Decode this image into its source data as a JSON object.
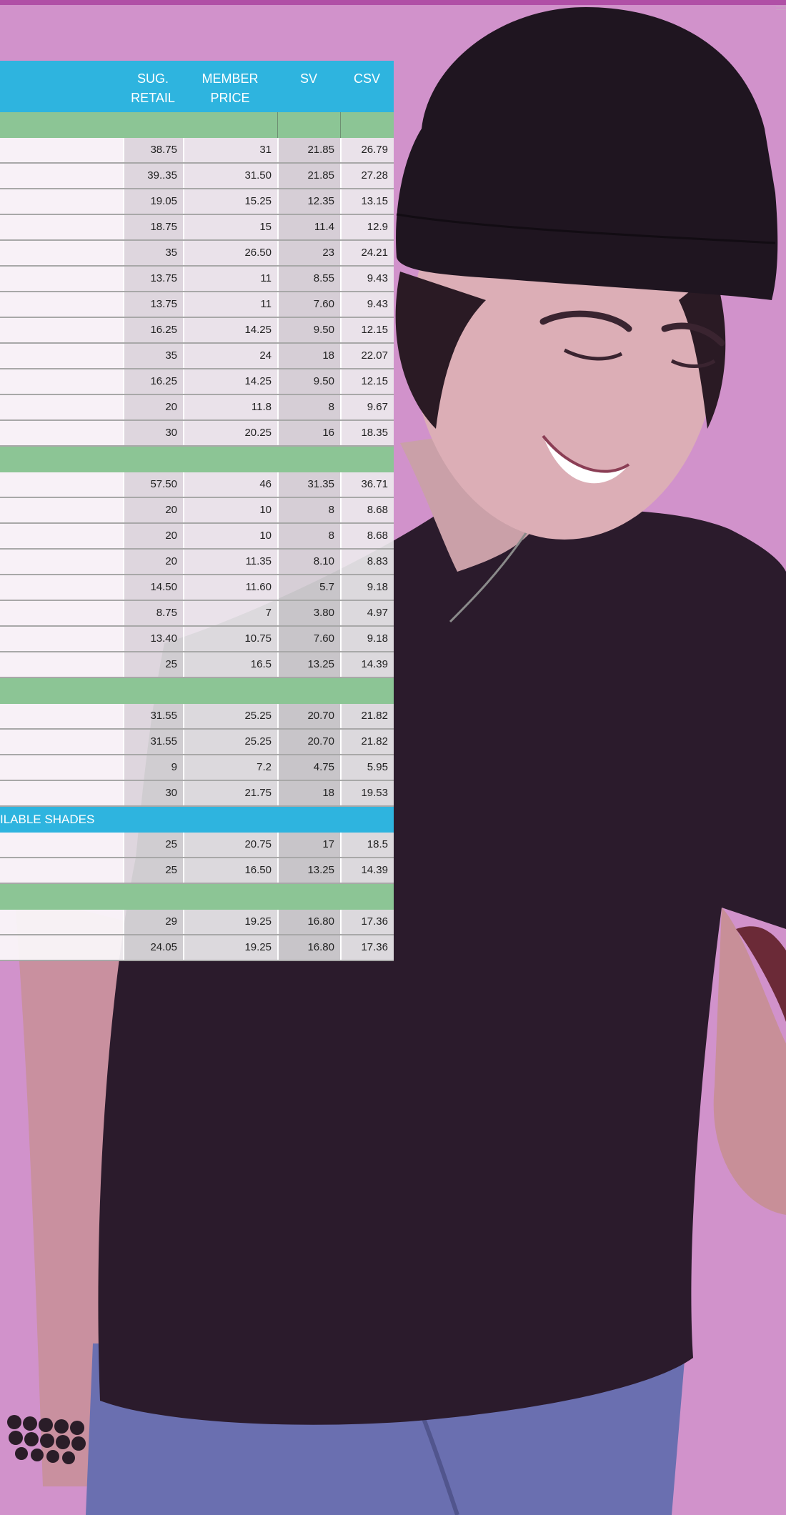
{
  "header": {
    "sug_retail": "SUG.\nRETAIL",
    "member_price": "MEMBER\nPRICE",
    "sv": "SV",
    "csv": "CSV"
  },
  "shades_label": "ILABLE SHADES",
  "colors": {
    "header_blue": "#2eb4df",
    "section_green": "#8cc595",
    "background_pink": "#d192cb",
    "top_bar": "#b04fa6"
  },
  "groups": [
    {
      "rows": [
        [
          "38.75",
          "31",
          "21.85",
          "26.79"
        ],
        [
          "39..35",
          "31.50",
          "21.85",
          "27.28"
        ],
        [
          "19.05",
          "15.25",
          "12.35",
          "13.15"
        ],
        [
          "18.75",
          "15",
          "11.4",
          "12.9"
        ],
        [
          "35",
          "26.50",
          "23",
          "24.21"
        ],
        [
          "13.75",
          "11",
          "8.55",
          "9.43"
        ],
        [
          "13.75",
          "11",
          "7.60",
          "9.43"
        ],
        [
          "16.25",
          "14.25",
          "9.50",
          "12.15"
        ],
        [
          "35",
          "24",
          "18",
          "22.07"
        ],
        [
          "16.25",
          "14.25",
          "9.50",
          "12.15"
        ],
        [
          "20",
          "11.8",
          "8",
          "9.67"
        ],
        [
          "30",
          "20.25",
          "16",
          "18.35"
        ]
      ]
    },
    {
      "rows": [
        [
          "57.50",
          "46",
          "31.35",
          "36.71"
        ],
        [
          "20",
          "10",
          "8",
          "8.68"
        ],
        [
          "20",
          "10",
          "8",
          "8.68"
        ],
        [
          "20",
          "11.35",
          "8.10",
          "8.83"
        ],
        [
          "14.50",
          "11.60",
          "5.7",
          "9.18"
        ],
        [
          "8.75",
          "7",
          "3.80",
          "4.97"
        ],
        [
          "13.40",
          "10.75",
          "7.60",
          "9.18"
        ],
        [
          "25",
          "16.5",
          "13.25",
          "14.39"
        ]
      ]
    },
    {
      "rows": [
        [
          "31.55",
          "25.25",
          "20.70",
          "21.82"
        ],
        [
          "31.55",
          "25.25",
          "20.70",
          "21.82"
        ],
        [
          "9",
          "7.2",
          "4.75",
          "5.95"
        ],
        [
          "30",
          "21.75",
          "18",
          "19.53"
        ]
      ]
    },
    {
      "blue_label": true,
      "rows": [
        [
          "25",
          "20.75",
          "17",
          "18.5"
        ],
        [
          "25",
          "16.50",
          "13.25",
          "14.39"
        ]
      ]
    },
    {
      "rows": [
        [
          "29",
          "19.25",
          "16.80",
          "17.36"
        ],
        [
          "24.05",
          "19.25",
          "16.80",
          "17.36"
        ]
      ]
    }
  ]
}
